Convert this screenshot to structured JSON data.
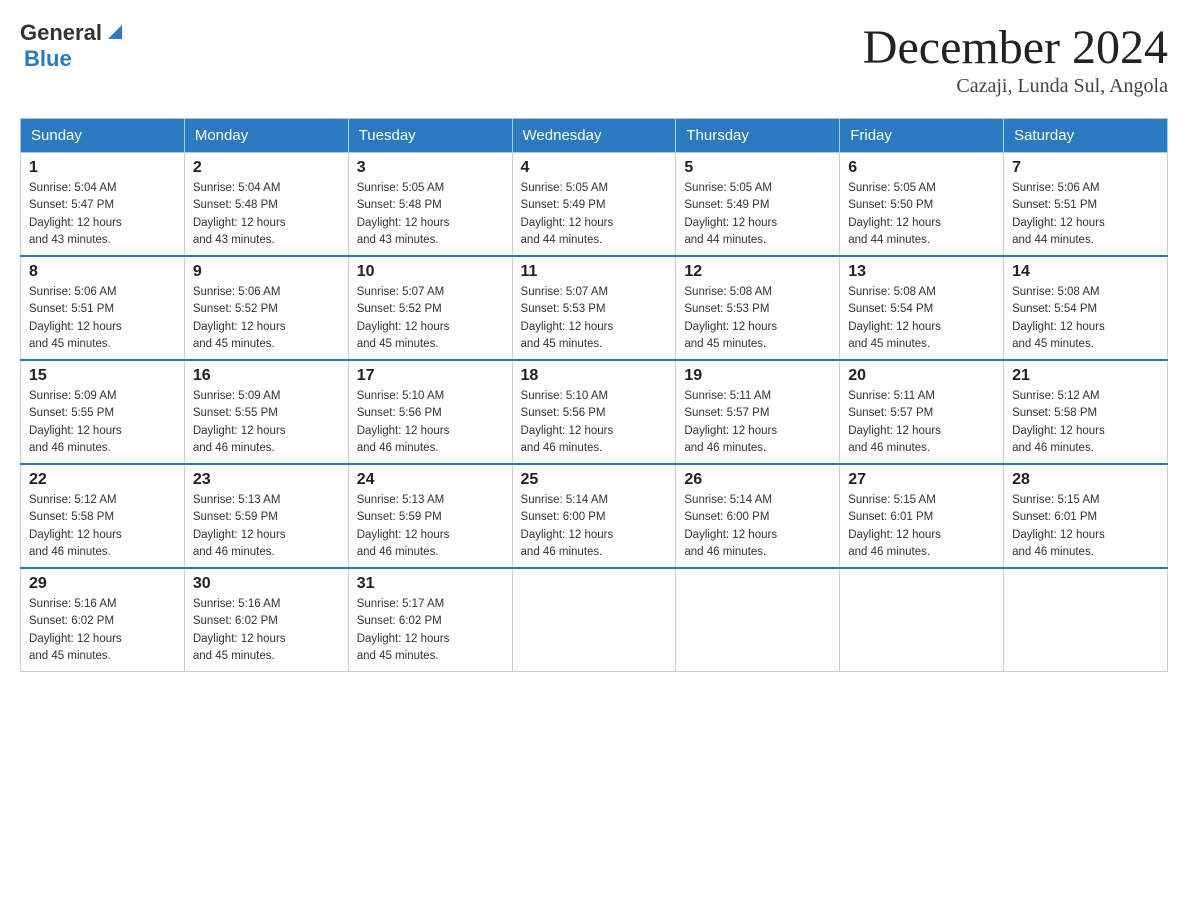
{
  "header": {
    "logo_general": "General",
    "logo_blue": "Blue",
    "month_title": "December 2024",
    "subtitle": "Cazaji, Lunda Sul, Angola"
  },
  "weekdays": [
    "Sunday",
    "Monday",
    "Tuesday",
    "Wednesday",
    "Thursday",
    "Friday",
    "Saturday"
  ],
  "weeks": [
    [
      {
        "day": "1",
        "sunrise": "5:04 AM",
        "sunset": "5:47 PM",
        "daylight": "12 hours and 43 minutes."
      },
      {
        "day": "2",
        "sunrise": "5:04 AM",
        "sunset": "5:48 PM",
        "daylight": "12 hours and 43 minutes."
      },
      {
        "day": "3",
        "sunrise": "5:05 AM",
        "sunset": "5:48 PM",
        "daylight": "12 hours and 43 minutes."
      },
      {
        "day": "4",
        "sunrise": "5:05 AM",
        "sunset": "5:49 PM",
        "daylight": "12 hours and 44 minutes."
      },
      {
        "day": "5",
        "sunrise": "5:05 AM",
        "sunset": "5:49 PM",
        "daylight": "12 hours and 44 minutes."
      },
      {
        "day": "6",
        "sunrise": "5:05 AM",
        "sunset": "5:50 PM",
        "daylight": "12 hours and 44 minutes."
      },
      {
        "day": "7",
        "sunrise": "5:06 AM",
        "sunset": "5:51 PM",
        "daylight": "12 hours and 44 minutes."
      }
    ],
    [
      {
        "day": "8",
        "sunrise": "5:06 AM",
        "sunset": "5:51 PM",
        "daylight": "12 hours and 45 minutes."
      },
      {
        "day": "9",
        "sunrise": "5:06 AM",
        "sunset": "5:52 PM",
        "daylight": "12 hours and 45 minutes."
      },
      {
        "day": "10",
        "sunrise": "5:07 AM",
        "sunset": "5:52 PM",
        "daylight": "12 hours and 45 minutes."
      },
      {
        "day": "11",
        "sunrise": "5:07 AM",
        "sunset": "5:53 PM",
        "daylight": "12 hours and 45 minutes."
      },
      {
        "day": "12",
        "sunrise": "5:08 AM",
        "sunset": "5:53 PM",
        "daylight": "12 hours and 45 minutes."
      },
      {
        "day": "13",
        "sunrise": "5:08 AM",
        "sunset": "5:54 PM",
        "daylight": "12 hours and 45 minutes."
      },
      {
        "day": "14",
        "sunrise": "5:08 AM",
        "sunset": "5:54 PM",
        "daylight": "12 hours and 45 minutes."
      }
    ],
    [
      {
        "day": "15",
        "sunrise": "5:09 AM",
        "sunset": "5:55 PM",
        "daylight": "12 hours and 46 minutes."
      },
      {
        "day": "16",
        "sunrise": "5:09 AM",
        "sunset": "5:55 PM",
        "daylight": "12 hours and 46 minutes."
      },
      {
        "day": "17",
        "sunrise": "5:10 AM",
        "sunset": "5:56 PM",
        "daylight": "12 hours and 46 minutes."
      },
      {
        "day": "18",
        "sunrise": "5:10 AM",
        "sunset": "5:56 PM",
        "daylight": "12 hours and 46 minutes."
      },
      {
        "day": "19",
        "sunrise": "5:11 AM",
        "sunset": "5:57 PM",
        "daylight": "12 hours and 46 minutes."
      },
      {
        "day": "20",
        "sunrise": "5:11 AM",
        "sunset": "5:57 PM",
        "daylight": "12 hours and 46 minutes."
      },
      {
        "day": "21",
        "sunrise": "5:12 AM",
        "sunset": "5:58 PM",
        "daylight": "12 hours and 46 minutes."
      }
    ],
    [
      {
        "day": "22",
        "sunrise": "5:12 AM",
        "sunset": "5:58 PM",
        "daylight": "12 hours and 46 minutes."
      },
      {
        "day": "23",
        "sunrise": "5:13 AM",
        "sunset": "5:59 PM",
        "daylight": "12 hours and 46 minutes."
      },
      {
        "day": "24",
        "sunrise": "5:13 AM",
        "sunset": "5:59 PM",
        "daylight": "12 hours and 46 minutes."
      },
      {
        "day": "25",
        "sunrise": "5:14 AM",
        "sunset": "6:00 PM",
        "daylight": "12 hours and 46 minutes."
      },
      {
        "day": "26",
        "sunrise": "5:14 AM",
        "sunset": "6:00 PM",
        "daylight": "12 hours and 46 minutes."
      },
      {
        "day": "27",
        "sunrise": "5:15 AM",
        "sunset": "6:01 PM",
        "daylight": "12 hours and 46 minutes."
      },
      {
        "day": "28",
        "sunrise": "5:15 AM",
        "sunset": "6:01 PM",
        "daylight": "12 hours and 46 minutes."
      }
    ],
    [
      {
        "day": "29",
        "sunrise": "5:16 AM",
        "sunset": "6:02 PM",
        "daylight": "12 hours and 45 minutes."
      },
      {
        "day": "30",
        "sunrise": "5:16 AM",
        "sunset": "6:02 PM",
        "daylight": "12 hours and 45 minutes."
      },
      {
        "day": "31",
        "sunrise": "5:17 AM",
        "sunset": "6:02 PM",
        "daylight": "12 hours and 45 minutes."
      },
      null,
      null,
      null,
      null
    ]
  ],
  "labels": {
    "sunrise": "Sunrise:",
    "sunset": "Sunset:",
    "daylight": "Daylight:"
  }
}
